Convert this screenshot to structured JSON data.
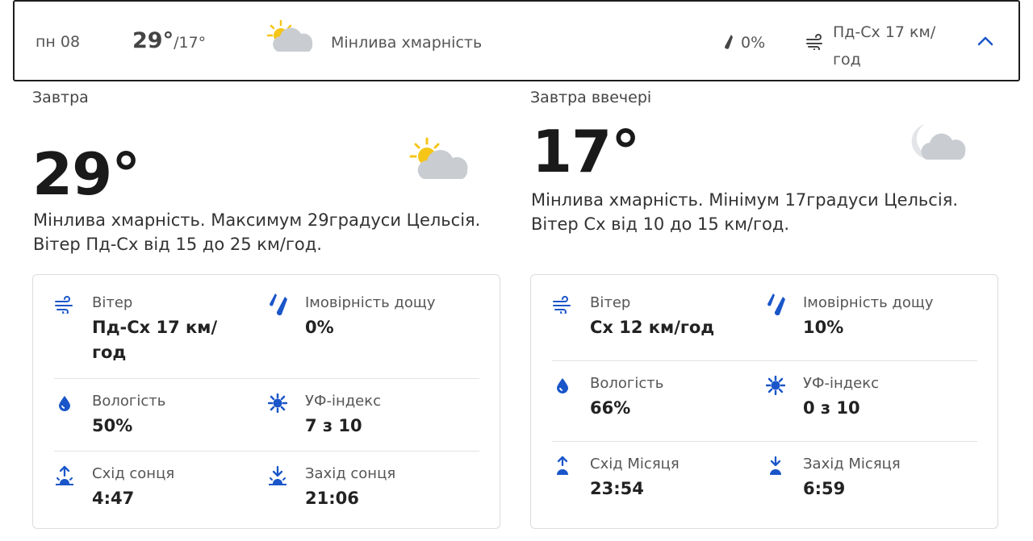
{
  "day_row": {
    "date": "пн 08",
    "temp_high": "29°",
    "temp_low": "/17°",
    "condition": "Мінлива хмарність",
    "rain": "0%",
    "wind": "Пд-Сх 17 км/год"
  },
  "tomorrow": {
    "period": "Завтра",
    "temp": "29°",
    "description": "Мінлива хмарність. Максимум 29градуси Цельсія. Вітер Пд-Сх від 15 до 25 км/год.",
    "wind_label": "Вітер",
    "wind_value": "Пд-Сх 17 км/год",
    "rain_label": "Імовірність дощу",
    "rain_value": "0%",
    "humidity_label": "Вологість",
    "humidity_value": "50%",
    "uv_label": "УФ-індекс",
    "uv_value": "7 з 10",
    "sunrise_label": "Схід сонця",
    "sunrise_value": "4:47",
    "sunset_label": "Захід сонця",
    "sunset_value": "21:06"
  },
  "tomorrow_evening": {
    "period": "Завтра ввечері",
    "temp": "17°",
    "description": "Мінлива хмарність. Мінімум 17градуси Цельсія. Вітер Сх від 10 до 15 км/год.",
    "wind_label": "Вітер",
    "wind_value": "Сх 12 км/год",
    "rain_label": "Імовірність дощу",
    "rain_value": "10%",
    "humidity_label": "Вологість",
    "humidity_value": "66%",
    "uv_label": "УФ-індекс",
    "uv_value": "0 з 10",
    "moonrise_label": "Схід Місяця",
    "moonrise_value": "23:54",
    "moonset_label": "Захід Місяця",
    "moonset_value": "6:59"
  },
  "colors": {
    "accent": "#1a56c9",
    "sun": "#f5c518",
    "cloud": "#c9cdd2"
  },
  "icons": [
    "partly-cloudy-icon",
    "partly-cloudy-night-icon",
    "raindrop-icon",
    "wind-icon",
    "chevron-up-icon",
    "humidity-icon",
    "uv-icon",
    "sunrise-icon",
    "sunset-icon",
    "moonrise-icon",
    "moonset-icon"
  ]
}
